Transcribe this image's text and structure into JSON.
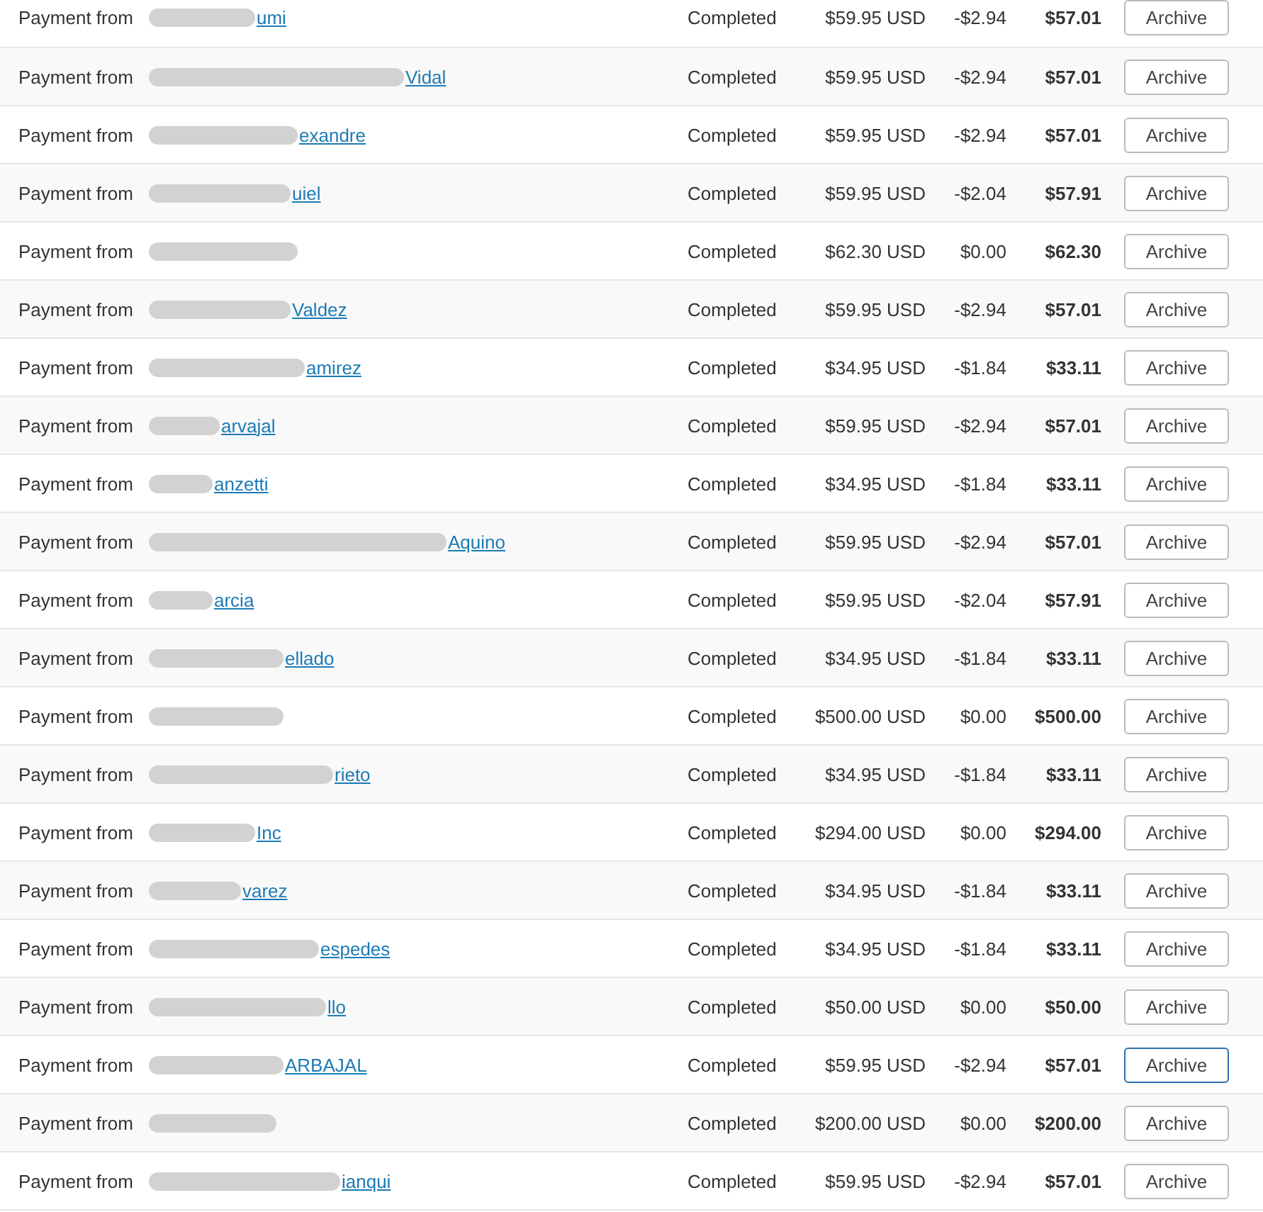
{
  "payments": [
    {
      "label": "Payment from",
      "name": "umi",
      "status": "Completed",
      "amount": "$59.95 USD",
      "fee": "-$2.94",
      "net": "$57.01",
      "button": "Archive",
      "focused": false
    },
    {
      "label": "Payment from",
      "name": "Vidal",
      "status": "Completed",
      "amount": "$59.95 USD",
      "fee": "-$2.94",
      "net": "$57.01",
      "button": "Archive",
      "focused": false
    },
    {
      "label": "Payment from",
      "name": "exandre",
      "status": "Completed",
      "amount": "$59.95 USD",
      "fee": "-$2.94",
      "net": "$57.01",
      "button": "Archive",
      "focused": false
    },
    {
      "label": "Payment from",
      "name": "uiel",
      "status": "Completed",
      "amount": "$59.95 USD",
      "fee": "-$2.04",
      "net": "$57.91",
      "button": "Archive",
      "focused": false
    },
    {
      "label": "Payment from",
      "status": "Completed",
      "amount": "$62.30 USD",
      "fee": "$0.00",
      "net": "$62.30",
      "button": "Archive",
      "focused": false
    },
    {
      "label": "Payment from",
      "name": "Valdez",
      "status": "Completed",
      "amount": "$59.95 USD",
      "fee": "-$2.94",
      "net": "$57.01",
      "button": "Archive",
      "focused": false
    },
    {
      "label": "Payment from",
      "name": "amirez",
      "status": "Completed",
      "amount": "$34.95 USD",
      "fee": "-$1.84",
      "net": "$33.11",
      "button": "Archive",
      "focused": false
    },
    {
      "label": "Payment from",
      "name": "arvajal",
      "status": "Completed",
      "amount": "$59.95 USD",
      "fee": "-$2.94",
      "net": "$57.01",
      "button": "Archive",
      "focused": false
    },
    {
      "label": "Payment from",
      "name": "anzetti",
      "status": "Completed",
      "amount": "$34.95 USD",
      "fee": "-$1.84",
      "net": "$33.11",
      "button": "Archive",
      "focused": false
    },
    {
      "label": "Payment from",
      "name": "Aquino",
      "status": "Completed",
      "amount": "$59.95 USD",
      "fee": "-$2.94",
      "net": "$57.01",
      "button": "Archive",
      "focused": false
    },
    {
      "label": "Payment from",
      "name": "arcia",
      "status": "Completed",
      "amount": "$59.95 USD",
      "fee": "-$2.04",
      "net": "$57.91",
      "button": "Archive",
      "focused": false
    },
    {
      "label": "Payment from",
      "name": "ellado",
      "status": "Completed",
      "amount": "$34.95 USD",
      "fee": "-$1.84",
      "net": "$33.11",
      "button": "Archive",
      "focused": false
    },
    {
      "label": "Payment from",
      "status": "Completed",
      "amount": "$500.00 USD",
      "fee": "$0.00",
      "net": "$500.00",
      "button": "Archive",
      "focused": false
    },
    {
      "label": "Payment from",
      "name": "rieto",
      "status": "Completed",
      "amount": "$34.95 USD",
      "fee": "-$1.84",
      "net": "$33.11",
      "button": "Archive",
      "focused": false
    },
    {
      "label": "Payment from",
      "name": "Inc",
      "status": "Completed",
      "amount": "$294.00 USD",
      "fee": "$0.00",
      "net": "$294.00",
      "button": "Archive",
      "focused": false
    },
    {
      "label": "Payment from",
      "name": "varez",
      "status": "Completed",
      "amount": "$34.95 USD",
      "fee": "-$1.84",
      "net": "$33.11",
      "button": "Archive",
      "focused": false
    },
    {
      "label": "Payment from",
      "name": "espedes",
      "status": "Completed",
      "amount": "$34.95 USD",
      "fee": "-$1.84",
      "net": "$33.11",
      "button": "Archive",
      "focused": false
    },
    {
      "label": "Payment from",
      "name": "llo",
      "status": "Completed",
      "amount": "$50.00 USD",
      "fee": "$0.00",
      "net": "$50.00",
      "button": "Archive",
      "focused": false
    },
    {
      "label": "Payment from",
      "name": "ARBAJAL",
      "status": "Completed",
      "amount": "$59.95 USD",
      "fee": "-$2.94",
      "net": "$57.01",
      "button": "Archive",
      "focused": true
    },
    {
      "label": "Payment from",
      "status": "Completed",
      "amount": "$200.00 USD",
      "fee": "$0.00",
      "net": "$200.00",
      "button": "Archive",
      "focused": false
    },
    {
      "label": "Payment from",
      "name": "ianqui",
      "status": "Completed",
      "amount": "$59.95 USD",
      "fee": "-$2.94",
      "net": "$57.01",
      "button": "Archive",
      "focused": false
    }
  ]
}
